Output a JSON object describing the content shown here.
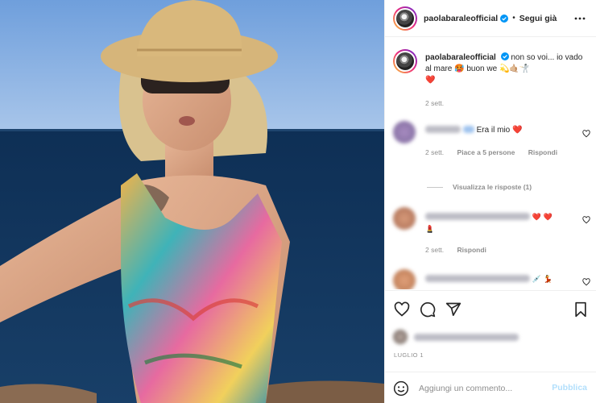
{
  "post": {
    "username": "paolabaraleofficial",
    "follow_label": "Segui già",
    "caption_text": "non so voi... io vado al mare 🥵 buon we 💫🤙🏼🤺",
    "caption_tail": "❤️",
    "caption_time": "2 sett."
  },
  "comments": [
    {
      "text": "Era il mio",
      "emoji": "❤️",
      "time": "2 sett.",
      "likes": "Piace a 5 persone",
      "reply": "Rispondi",
      "view_replies": "Visualizza le risposte (1)"
    },
    {
      "text": "",
      "emoji": "❤️ ❤️",
      "line2": "💄",
      "time": "2 sett.",
      "reply": "Rispondi"
    },
    {
      "text": "",
      "emoji": "💉 💃"
    }
  ],
  "footer": {
    "date": "LUGLIO 1",
    "comment_placeholder": "Aggiungi un commento...",
    "publish_label": "Pubblica"
  },
  "colors": {
    "accent": "#0095f6",
    "publish_disabled": "#b2dffc",
    "muted": "#8e8e8e",
    "heart": "#ed4956"
  },
  "icons": [
    "verified-badge-icon",
    "more-options-icon",
    "heart-icon",
    "comment-icon",
    "share-icon",
    "bookmark-icon",
    "emoji-icon"
  ]
}
